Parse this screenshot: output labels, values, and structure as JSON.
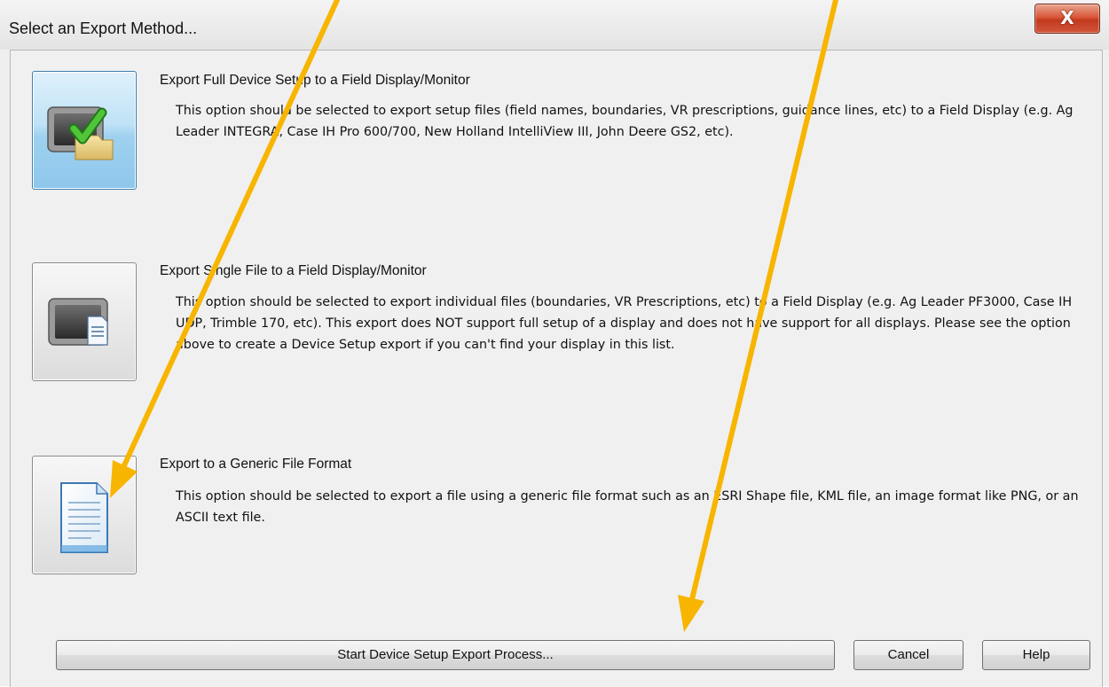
{
  "window": {
    "title": "Select an Export Method...",
    "close_label": "X"
  },
  "options": [
    {
      "title": "Export Full Device Setup to a Field Display/Monitor",
      "description": "This option should be selected to export setup files (field names, boundaries, VR prescriptions, guidance lines, etc) to a Field Display (e.g. Ag Leader INTEGRA, Case IH Pro 600/700, New Holland IntelliView III, John Deere GS2, etc).",
      "icon": "monitor-checkmark-icon",
      "selected": true
    },
    {
      "title": "Export Single File to a Field Display/Monitor",
      "description": "This option should be selected to export individual files (boundaries, VR Prescriptions, etc) to a Field Display (e.g. Ag Leader PF3000, Case IH UDP, Trimble 170, etc).  This export does NOT support full setup of a display and does not have support for all displays.  Please see the option above to create a Device Setup export if you can't find your display in this list.",
      "icon": "monitor-file-icon",
      "selected": false
    },
    {
      "title": "Export to a Generic File Format",
      "description": "This option should be selected to export a file using a generic file format such as an ESRI Shape file, KML file, an image format like PNG, or an ASCII text file.",
      "icon": "document-icon",
      "selected": false
    }
  ],
  "buttons": {
    "start": "Start Device Setup Export Process...",
    "cancel": "Cancel",
    "help": "Help"
  },
  "colors": {
    "annotation_arrow": "#f7b500",
    "selected_option": "#9fd1ef",
    "close_button": "#c9442a"
  }
}
